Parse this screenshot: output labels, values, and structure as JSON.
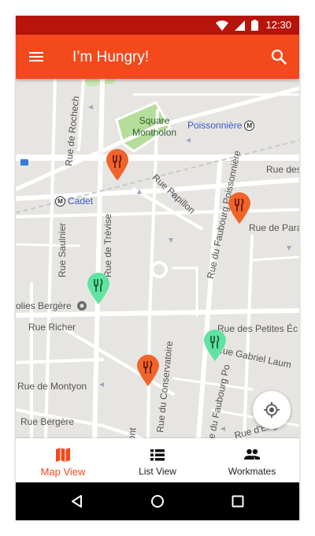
{
  "status_bar": {
    "time": "12:30",
    "icons": [
      "wifi-icon",
      "signal-icon",
      "battery-icon"
    ],
    "background": "#b7140b"
  },
  "app_bar": {
    "title": "I’m Hungry!",
    "menu_icon": "menu-icon",
    "search_icon": "search-icon",
    "background": "#f4481d"
  },
  "map": {
    "park_label_line1": "Square",
    "park_label_line2": "Montholon",
    "metro_stations": [
      {
        "name": "Poissonnière"
      },
      {
        "name": "Cadet"
      }
    ],
    "streets": [
      "Rue de Rochech",
      "Rue des Mes",
      "Rue Papillon",
      "Rue du Faubourg Poissonnière",
      "Rue de Paradis",
      "Rue Saulnier",
      "Rue de Trévise",
      "olies Bergère",
      "Rue Richer",
      "Rue des Petites Éc",
      "Rue Gabriel Laum",
      "Rue du Conservatoire",
      "Rue du Faubourg Po",
      "Rue de Montyon",
      "Rue Bergère",
      "emont",
      "Rue d'Eng"
    ],
    "pins": [
      {
        "color": "#f0642a",
        "kind": "restaurant"
      },
      {
        "color": "#f0642a",
        "kind": "restaurant"
      },
      {
        "color": "#5ee3a1",
        "kind": "restaurant"
      },
      {
        "color": "#5ee3a1",
        "kind": "restaurant"
      },
      {
        "color": "#f0642a",
        "kind": "restaurant"
      }
    ],
    "locate_icon": "my-location-icon"
  },
  "bottom_nav": {
    "items": [
      {
        "label": "Map View",
        "icon": "map-icon",
        "active": true
      },
      {
        "label": "List View",
        "icon": "list-icon",
        "active": false
      },
      {
        "label": "Workmates",
        "icon": "people-icon",
        "active": false
      }
    ],
    "active_color": "#f4481d"
  },
  "system_nav": {
    "buttons": [
      "back-icon",
      "home-icon",
      "recents-icon"
    ]
  }
}
